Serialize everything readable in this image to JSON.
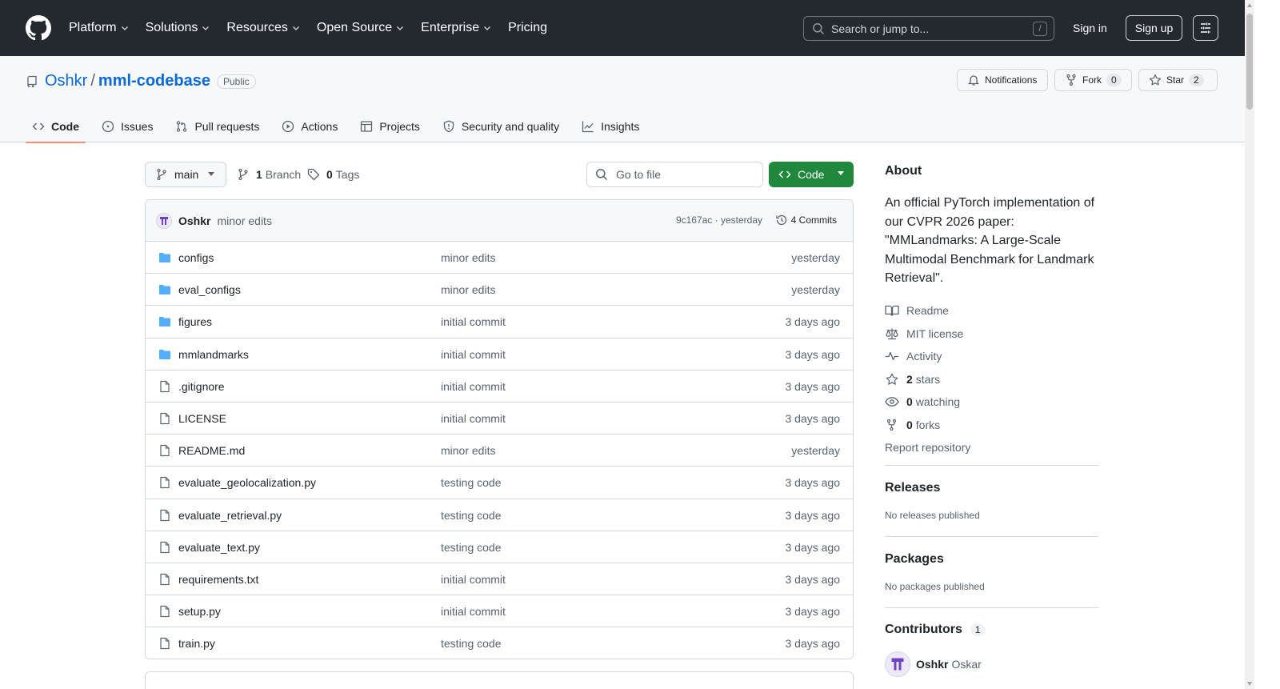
{
  "header": {
    "nav": [
      {
        "label": "Platform",
        "dropdown": true
      },
      {
        "label": "Solutions",
        "dropdown": true
      },
      {
        "label": "Resources",
        "dropdown": true
      },
      {
        "label": "Open Source",
        "dropdown": true
      },
      {
        "label": "Enterprise",
        "dropdown": true
      },
      {
        "label": "Pricing",
        "dropdown": false
      }
    ],
    "search_placeholder": "Search or jump to...",
    "search_shortcut": "/",
    "signin": "Sign in",
    "signup": "Sign up"
  },
  "repo": {
    "owner": "Oshkr",
    "separator": "/",
    "name": "mml-codebase",
    "visibility": "Public",
    "notifications_label": "Notifications",
    "fork_label": "Fork",
    "fork_count": "0",
    "star_label": "Star",
    "star_count": "2"
  },
  "tabs": [
    {
      "label": "Code",
      "icon": "code-icon",
      "active": true
    },
    {
      "label": "Issues",
      "icon": "issue-opened-icon",
      "active": false
    },
    {
      "label": "Pull requests",
      "icon": "git-pull-request-icon",
      "active": false
    },
    {
      "label": "Actions",
      "icon": "play-icon",
      "active": false
    },
    {
      "label": "Projects",
      "icon": "table-icon",
      "active": false
    },
    {
      "label": "Security and quality",
      "icon": "shield-icon",
      "active": false
    },
    {
      "label": "Insights",
      "icon": "graph-icon",
      "active": false
    }
  ],
  "branchbar": {
    "branch": "main",
    "branch_count": "1",
    "branch_word": "Branch",
    "tag_count": "0",
    "tag_word": "Tags",
    "goto_placeholder": "Go to file",
    "code_button": "Code"
  },
  "latest_commit": {
    "author": "Oshkr",
    "message": "minor edits",
    "sha_time": "9c167ac · yesterday",
    "commits_label": "4 Commits"
  },
  "files": [
    {
      "name": "configs",
      "type": "dir",
      "message": "minor edits",
      "date": "yesterday"
    },
    {
      "name": "eval_configs",
      "type": "dir",
      "message": "minor edits",
      "date": "yesterday"
    },
    {
      "name": "figures",
      "type": "dir",
      "message": "initial commit",
      "date": "3 days ago"
    },
    {
      "name": "mmlandmarks",
      "type": "dir",
      "message": "initial commit",
      "date": "3 days ago"
    },
    {
      "name": ".gitignore",
      "type": "file",
      "message": "initial commit",
      "date": "3 days ago"
    },
    {
      "name": "LICENSE",
      "type": "file",
      "message": "initial commit",
      "date": "3 days ago"
    },
    {
      "name": "README.md",
      "type": "file",
      "message": "minor edits",
      "date": "yesterday"
    },
    {
      "name": "evaluate_geolocalization.py",
      "type": "file",
      "message": "testing code",
      "date": "3 days ago"
    },
    {
      "name": "evaluate_retrieval.py",
      "type": "file",
      "message": "testing code",
      "date": "3 days ago"
    },
    {
      "name": "evaluate_text.py",
      "type": "file",
      "message": "testing code",
      "date": "3 days ago"
    },
    {
      "name": "requirements.txt",
      "type": "file",
      "message": "initial commit",
      "date": "3 days ago"
    },
    {
      "name": "setup.py",
      "type": "file",
      "message": "initial commit",
      "date": "3 days ago"
    },
    {
      "name": "train.py",
      "type": "file",
      "message": "testing code",
      "date": "3 days ago"
    }
  ],
  "sidebar": {
    "about_title": "About",
    "about_text": "An official PyTorch implementation of our CVPR 2026 paper: \"MMLandmarks: A Large-Scale Multimodal Benchmark for Landmark Retrieval\".",
    "links": [
      {
        "icon": "book-icon",
        "bold": "",
        "label": "Readme"
      },
      {
        "icon": "law-icon",
        "bold": "",
        "label": "MIT license"
      },
      {
        "icon": "pulse-icon",
        "bold": "",
        "label": "Activity"
      },
      {
        "icon": "star-icon",
        "bold": "2",
        "label": "stars"
      },
      {
        "icon": "eye-icon",
        "bold": "0",
        "label": "watching"
      },
      {
        "icon": "repo-forked-icon",
        "bold": "0",
        "label": "forks"
      }
    ],
    "report": "Report repository",
    "releases_title": "Releases",
    "releases_text": "No releases published",
    "packages_title": "Packages",
    "packages_text": "No packages published",
    "contributors_title": "Contributors",
    "contributors_count": "1",
    "contributor_login": "Oshkr",
    "contributor_name": "Oskar"
  },
  "colors": {
    "header_bg": "#24292f",
    "accent_link": "#0969da",
    "code_button": "#1f883d",
    "tab_underline": "#fd8c73",
    "folder": "#54aeff"
  }
}
